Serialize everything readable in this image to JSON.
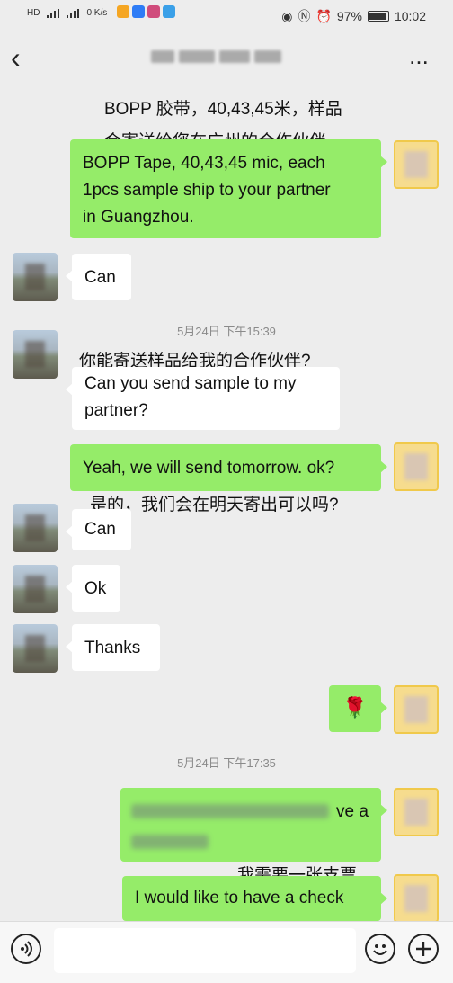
{
  "status_bar": {
    "left_indicators": [
      "HD",
      "4G",
      "4G",
      "0 K/s"
    ],
    "battery": "97%",
    "battery_level": 0.97,
    "time": "10:02"
  },
  "nav": {
    "back_icon": "chevron-left-icon",
    "more_label": "..."
  },
  "messages": [
    {
      "side": "right",
      "text": "BOPP Tape, 40,43,45 mic, each\n1pcs sample ship to your partner\nin Guangzhou."
    },
    {
      "side": "left",
      "text": "Can"
    },
    {
      "side": "left",
      "text": "Can you send sample to my\npartner?"
    },
    {
      "side": "right",
      "text": "Yeah, we will send tomorrow. ok?"
    },
    {
      "side": "left",
      "text": "Can"
    },
    {
      "side": "left",
      "text": "Ok"
    },
    {
      "side": "left",
      "text": "Thanks"
    },
    {
      "side": "right",
      "text": "🌹"
    },
    {
      "side": "right",
      "text": "ve a"
    },
    {
      "side": "right",
      "text": "I would like to have a check"
    }
  ],
  "timestamps": [
    "5月24日 下午15:39",
    "5月24日 下午17:35"
  ],
  "overlays": [
    "BOPP 胶带，40,43,45米，样品",
    "会寄送给您在广州的合作伙伴 。",
    "你能寄送样品给我的合作伙伴?",
    "是的，我们会在明天寄出可以吗?",
    "我需要一张支票"
  ],
  "input_bar": {
    "voice": "voice-icon",
    "emoji": "emoji-icon",
    "plus": "plus-icon"
  }
}
